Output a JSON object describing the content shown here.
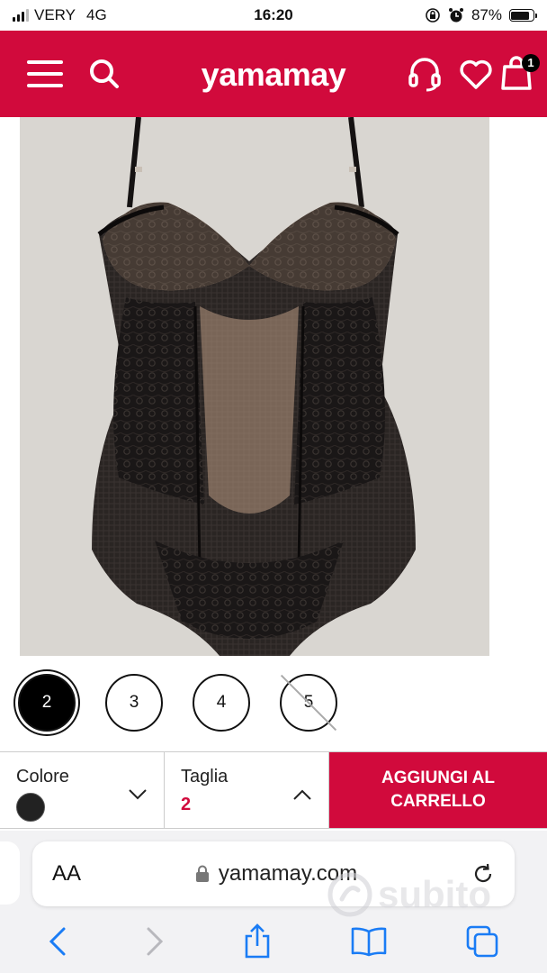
{
  "status": {
    "carrier": "VERY",
    "network": "4G",
    "time": "16:20",
    "battery": "87%"
  },
  "header": {
    "brand": "yamamay",
    "cart_count": "1"
  },
  "product": {
    "image_alt": "black lace bodysuit"
  },
  "sizes": [
    {
      "label": "2",
      "state": "selected"
    },
    {
      "label": "3",
      "state": "available"
    },
    {
      "label": "4",
      "state": "available"
    },
    {
      "label": "5",
      "state": "unavailable"
    }
  ],
  "selector": {
    "color_label": "Colore",
    "color_value": "#222222",
    "size_label": "Taglia",
    "size_value": "2",
    "add_to_cart": "AGGIUNGI AL CARRELLO"
  },
  "browser": {
    "aa": "AA",
    "url": "yamamay.com"
  },
  "watermark": "subito",
  "colors": {
    "brand": "#d10a3c"
  }
}
